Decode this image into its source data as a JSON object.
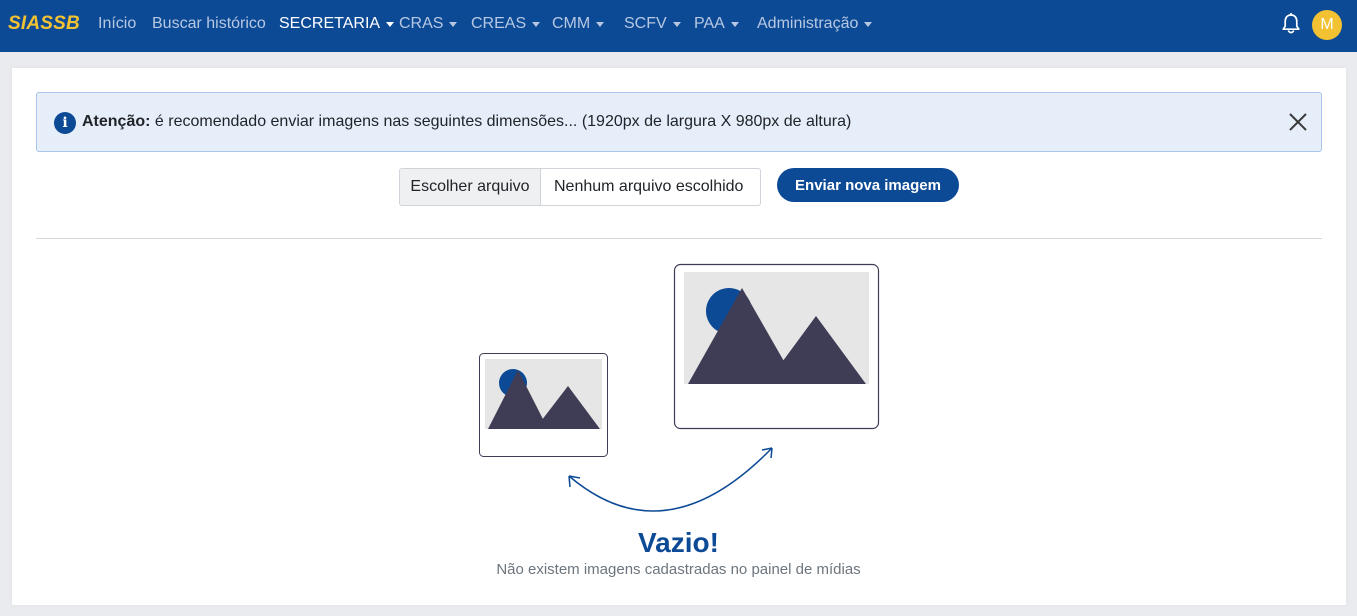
{
  "app": {
    "brand": "SIASSB",
    "avatar_initial": "M"
  },
  "nav": {
    "items": [
      {
        "label": "Início",
        "has_dropdown": false,
        "active": false
      },
      {
        "label": "Buscar histórico",
        "has_dropdown": false,
        "active": false
      },
      {
        "label": "SECRETARIA",
        "has_dropdown": true,
        "active": true
      },
      {
        "label": "CRAS",
        "has_dropdown": true,
        "active": false
      },
      {
        "label": "CREAS",
        "has_dropdown": true,
        "active": false
      },
      {
        "label": "CMM",
        "has_dropdown": true,
        "active": false
      },
      {
        "label": "SCFV",
        "has_dropdown": true,
        "active": false
      },
      {
        "label": "PAA",
        "has_dropdown": true,
        "active": false
      },
      {
        "label": "Administração",
        "has_dropdown": true,
        "active": false
      }
    ],
    "icons": {
      "notifications": "bell-icon"
    }
  },
  "alert": {
    "strong": "Atenção:",
    "message": " é recomendado enviar imagens nas seguintes dimensões... (1920px de largura X 980px de altura)",
    "icon": "info-icon",
    "close_icon": "close-icon"
  },
  "upload": {
    "choose_label": "Escolher arquivo",
    "no_file_label": "Nenhum arquivo escolhido",
    "submit_label": "Enviar nova imagem"
  },
  "empty_state": {
    "title": "Vazio!",
    "subtitle": "Não existem imagens cadastradas no painel de mídias"
  },
  "colors": {
    "primary": "#0d4a96",
    "brand_accent": "#f2c232",
    "alert_bg": "#e6eefa",
    "mountain": "#3f3d56"
  }
}
